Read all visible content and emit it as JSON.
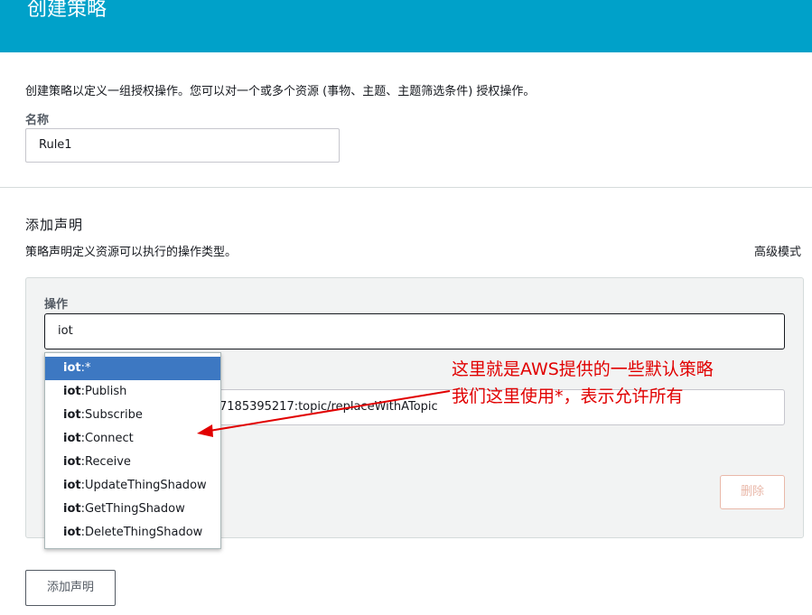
{
  "header": {
    "title": "创建策略"
  },
  "form": {
    "description": "创建策略以定义一组授权操作。您可以对一个或多个资源 (事物、主题、主题筛选条件) 授权操作。",
    "name_label": "名称",
    "name_value": "Rule1"
  },
  "statement": {
    "title": "添加声明",
    "description": "策略声明定义资源可以执行的操作类型。",
    "advanced_mode_label": "高级模式",
    "action_label": "操作",
    "action_value": "iot",
    "resource_value_visible": "7185395217:topic/replaceWithATopic",
    "delete_label": "删除",
    "add_statement_label": "添加声明"
  },
  "dropdown": {
    "keyword": "iot",
    "items": [
      {
        "suffix": ":*"
      },
      {
        "suffix": ":Publish"
      },
      {
        "suffix": ":Subscribe"
      },
      {
        "suffix": ":Connect"
      },
      {
        "suffix": ":Receive"
      },
      {
        "suffix": ":UpdateThingShadow"
      },
      {
        "suffix": ":GetThingShadow"
      },
      {
        "suffix": ":DeleteThingShadow"
      }
    ],
    "selected_index": 0
  },
  "annotation": {
    "line1": "这里就是AWS提供的一些默认策略",
    "line2": "我们这里使用*，表示允许所有",
    "color": "#e10000"
  },
  "colors": {
    "header": "#00a1c9",
    "selected_item": "#3d78c2"
  }
}
